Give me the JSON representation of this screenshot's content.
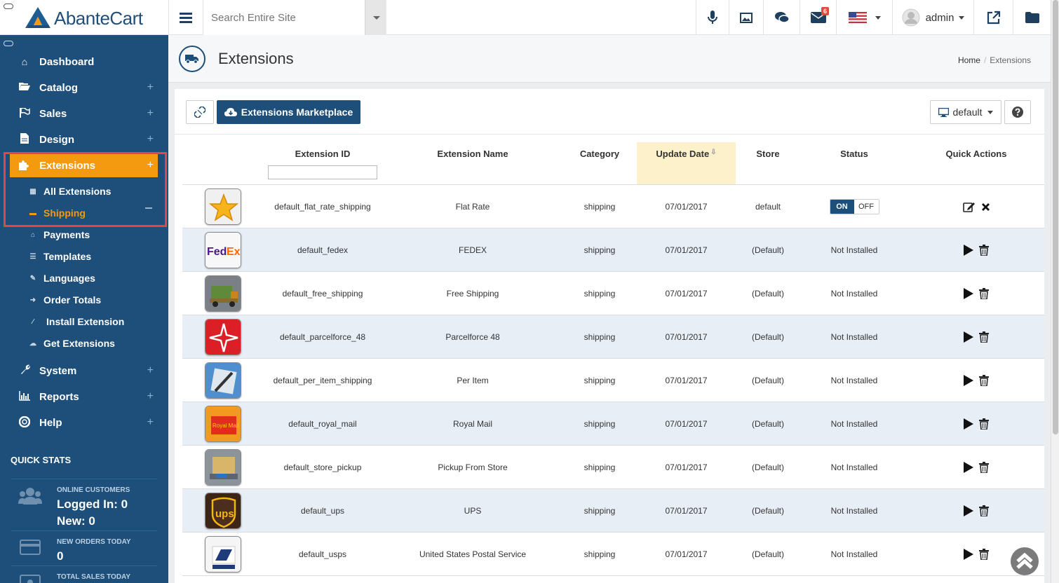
{
  "app": {
    "brand": "AbanteCart"
  },
  "header": {
    "search_placeholder": "Search Entire Site",
    "mail_badge": "6",
    "admin_label": "admin"
  },
  "sidebar": {
    "items": [
      {
        "label": "Dashboard",
        "icon": "home-icon"
      },
      {
        "label": "Catalog",
        "icon": "folder-open-icon"
      },
      {
        "label": "Sales",
        "icon": "flag-icon"
      },
      {
        "label": "Design",
        "icon": "file-icon"
      },
      {
        "label": "Extensions",
        "icon": "puzzle-icon"
      },
      {
        "label": "System",
        "icon": "wrench-icon"
      },
      {
        "label": "Reports",
        "icon": "bar-chart-icon"
      },
      {
        "label": "Help",
        "icon": "lifebuoy-icon"
      }
    ],
    "extensions_sub": [
      {
        "label": "All Extensions",
        "icon": "grid-icon"
      },
      {
        "label": "Shipping",
        "icon": "truck-icon"
      },
      {
        "label": "Payments",
        "icon": "bank-icon"
      },
      {
        "label": "Templates",
        "icon": "list-icon"
      },
      {
        "label": "Languages",
        "icon": "language-icon"
      },
      {
        "label": "Order Totals",
        "icon": "sign-in-icon"
      },
      {
        "label": "Install Extension",
        "icon": "magic-icon"
      },
      {
        "label": "Get Extensions",
        "icon": "cloud-download-icon"
      }
    ],
    "quick_stats": {
      "title": "QUICK STATS",
      "online_label": "ONLINE CUSTOMERS",
      "logged_in": "Logged In: 0",
      "new": "New: 0",
      "orders_label": "NEW ORDERS TODAY",
      "orders_value": "0",
      "sales_label": "TOTAL SALES TODAY"
    }
  },
  "page": {
    "title": "Extensions",
    "breadcrumb": [
      "Home",
      "Extensions"
    ]
  },
  "toolbar": {
    "market_label": "Extensions Marketplace",
    "store_label": "default"
  },
  "table": {
    "columns": [
      "Extension ID",
      "Extension Name",
      "Category",
      "Update Date",
      "Store",
      "Status",
      "Quick Actions"
    ],
    "rows": [
      {
        "id": "default_flat_rate_shipping",
        "name": "Flat Rate",
        "category": "shipping",
        "date": "07/01/2017",
        "store": "default",
        "status": "toggle",
        "on": "ON",
        "off": "OFF",
        "thumb": "star"
      },
      {
        "id": "default_fedex",
        "name": "FEDEX",
        "category": "shipping",
        "date": "07/01/2017",
        "store": "(Default)",
        "status": "Not Installed",
        "thumb": "fedex"
      },
      {
        "id": "default_free_shipping",
        "name": "Free Shipping",
        "category": "shipping",
        "date": "07/01/2017",
        "store": "(Default)",
        "status": "Not Installed",
        "thumb": "truck"
      },
      {
        "id": "default_parcelforce_48",
        "name": "Parcelforce 48",
        "category": "shipping",
        "date": "07/01/2017",
        "store": "(Default)",
        "status": "Not Installed",
        "thumb": "parcelforce"
      },
      {
        "id": "default_per_item_shipping",
        "name": "Per Item",
        "category": "shipping",
        "date": "07/01/2017",
        "store": "(Default)",
        "status": "Not Installed",
        "thumb": "peritem"
      },
      {
        "id": "default_royal_mail",
        "name": "Royal Mail",
        "category": "shipping",
        "date": "07/01/2017",
        "store": "(Default)",
        "status": "Not Installed",
        "thumb": "royalmail"
      },
      {
        "id": "default_store_pickup",
        "name": "Pickup From Store",
        "category": "shipping",
        "date": "07/01/2017",
        "store": "(Default)",
        "status": "Not Installed",
        "thumb": "pickup"
      },
      {
        "id": "default_ups",
        "name": "UPS",
        "category": "shipping",
        "date": "07/01/2017",
        "store": "(Default)",
        "status": "Not Installed",
        "thumb": "ups"
      },
      {
        "id": "default_usps",
        "name": "United States Postal Service",
        "category": "shipping",
        "date": "07/01/2017",
        "store": "(Default)",
        "status": "Not Installed",
        "thumb": "usps"
      }
    ]
  },
  "colors": {
    "sidebar": "#1d4f7a",
    "accent": "#f49a11",
    "highlight": "#e2483f"
  }
}
